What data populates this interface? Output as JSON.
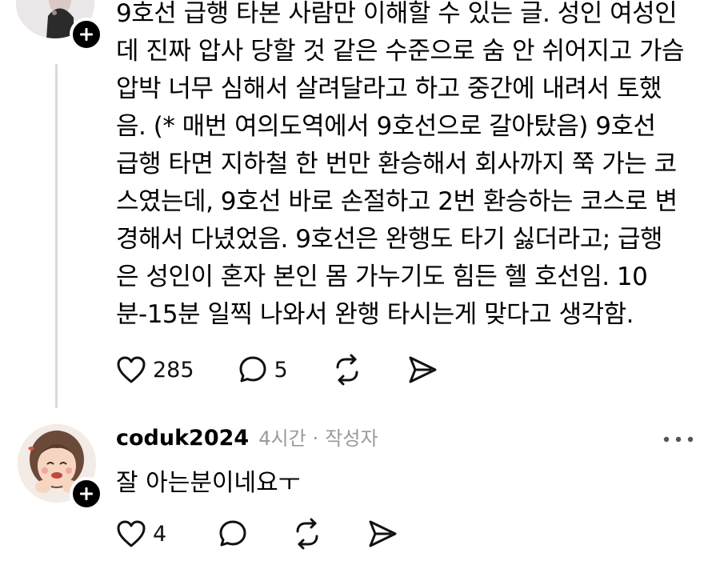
{
  "post": {
    "lines": [
      "9호선 급행 타본 사람만 이해할 수 있는 글. 성인 여성인",
      "데 진짜 압사 당할 것 같은 수준으로 숨 안 쉬어지고 가슴",
      "압박 너무 심해서 살려달라고 하고 중간에 내려서 토했",
      "음. (* 매번 여의도역에서 9호선으로 갈아탔음) 9호선",
      "급행 타면 지하철 한 번만 환승해서 회사까지 쭉 가는 코",
      "스였는데, 9호선 바로 손절하고 2번 환승하는 코스로 변",
      "경해서 다녔었음. 9호선은 완행도 타기 싫더라고; 급행",
      "은 성인이 혼자 본인 몸 가누기도 힘든 헬 호선임. 10",
      "분-15분 일찍 나와서 완행 타시는게 맞다고 생각함."
    ],
    "likes": "285",
    "replies": "5"
  },
  "comment": {
    "username": "coduk2024",
    "time": "4시간",
    "separator": "·",
    "author_tag": "작성자",
    "text": "잘 아는분이네요ㅜ",
    "likes": "4"
  },
  "icons": {
    "like": "heart-icon",
    "reply": "speech-bubble-icon",
    "repost": "repost-icon",
    "share": "send-icon",
    "more": "more-dots-icon",
    "follow": "plus-icon"
  },
  "colors": {
    "text": "#000000",
    "meta": "#9a9a9a",
    "thread_line": "#d9d9d9"
  }
}
